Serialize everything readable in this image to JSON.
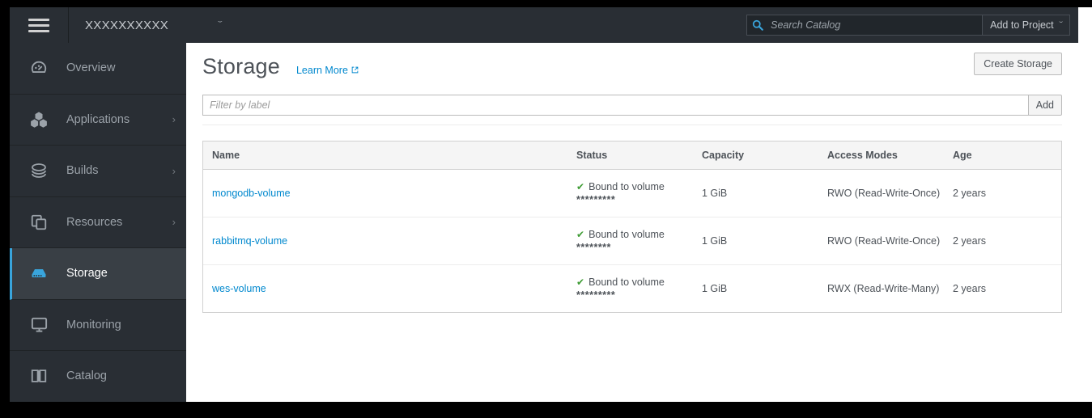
{
  "topbar": {
    "menu_icon": "hamburger-icon",
    "project_name": "XXXXXXXXXX",
    "project_caret": "ˇ",
    "search": {
      "icon": "search-icon",
      "placeholder": "Search Catalog",
      "value": ""
    },
    "add_to_project": {
      "label": "Add to Project",
      "caret": "ˇ"
    }
  },
  "sidebar": {
    "items": [
      {
        "label": "Overview",
        "icon": "dashboard-icon",
        "chevron": "",
        "active": false
      },
      {
        "label": "Applications",
        "icon": "cubes-icon",
        "chevron": "›",
        "active": false
      },
      {
        "label": "Builds",
        "icon": "layers-icon",
        "chevron": "›",
        "active": false
      },
      {
        "label": "Resources",
        "icon": "files-icon",
        "chevron": "›",
        "active": false
      },
      {
        "label": "Storage",
        "icon": "storage-icon",
        "chevron": "",
        "active": true
      },
      {
        "label": "Monitoring",
        "icon": "monitor-icon",
        "chevron": "",
        "active": false
      },
      {
        "label": "Catalog",
        "icon": "book-icon",
        "chevron": "",
        "active": false
      }
    ],
    "active_accent_color": "#39a5dc"
  },
  "main": {
    "page_title": "Storage",
    "learn_more_label": "Learn More",
    "learn_more_icon": "external-link-icon",
    "create_button_label": "Create Storage",
    "filter": {
      "placeholder": "Filter by label",
      "value": "",
      "add_button_label": "Add"
    },
    "table": {
      "columns": [
        "Name",
        "Status",
        "Capacity",
        "Access Modes",
        "Age"
      ],
      "rows": [
        {
          "name": "mongodb-volume",
          "status_text": "Bound to volume",
          "status_icon": "check-icon",
          "status_detail": "*********",
          "capacity": "1 GiB",
          "access_modes": "RWO (Read-Write-Once)",
          "age": "2 years"
        },
        {
          "name": "rabbitmq-volume",
          "status_text": "Bound to volume",
          "status_icon": "check-icon",
          "status_detail": "********",
          "capacity": "1 GiB",
          "access_modes": "RWO (Read-Write-Once)",
          "age": "2 years"
        },
        {
          "name": "wes-volume",
          "status_text": "Bound to volume",
          "status_icon": "check-icon",
          "status_detail": "*********",
          "capacity": "1 GiB",
          "access_modes": "RWX (Read-Write-Many)",
          "age": "2 years"
        }
      ]
    }
  },
  "colors": {
    "chrome_dark": "#292e34",
    "accent_blue": "#0088ce",
    "status_green": "#3f9c35"
  }
}
